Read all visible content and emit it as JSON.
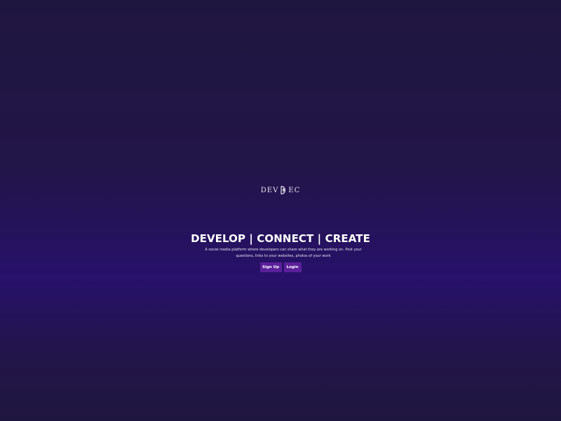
{
  "logo": {
    "left_text": "DEV",
    "right_text": "EC",
    "mark_icon": "pen-nib-d-icon"
  },
  "hero": {
    "title": "DEVELOP | CONNECT | CREATE",
    "description": "A social media platform where developers can share what they are working on. Post your questions, links to your websites, photos of your work"
  },
  "actions": {
    "signup_label": "Sign Up",
    "login_label": "Login"
  },
  "colors": {
    "background_top": "#1f1640",
    "background_mid": "#27116a",
    "button": "#5b1f9b",
    "text": "#ffffff"
  }
}
